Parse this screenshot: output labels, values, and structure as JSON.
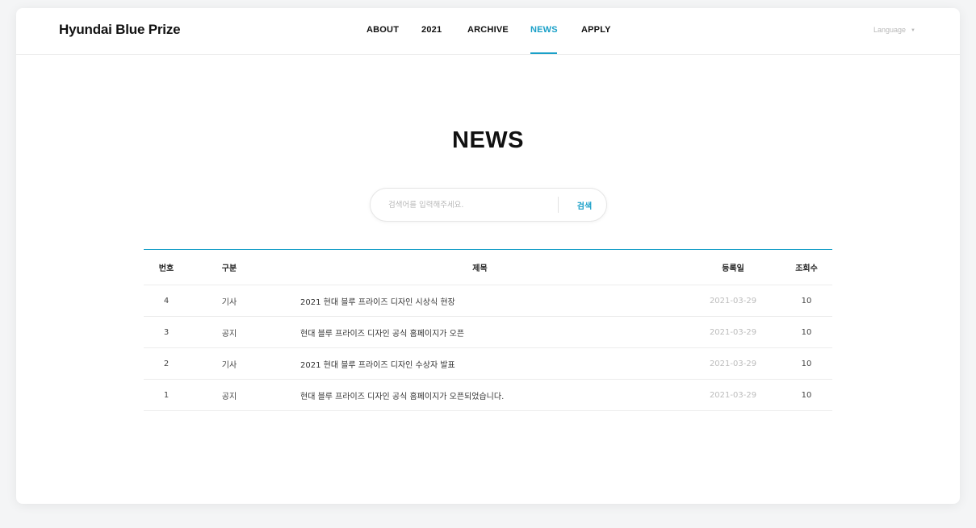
{
  "header": {
    "brand": "Hyundai Blue Prize",
    "nav": [
      {
        "label": "ABOUT"
      },
      {
        "label": "2021"
      },
      {
        "label": "ARCHIVE"
      },
      {
        "label": "NEWS"
      },
      {
        "label": "APPLY"
      }
    ],
    "active_nav": "NEWS",
    "language_label": "Language",
    "language_icon": "chevron-down-icon"
  },
  "page": {
    "title": "NEWS"
  },
  "search": {
    "placeholder": "검색어를 입력해주세요.",
    "value": "",
    "button_label": "검색"
  },
  "table": {
    "columns": [
      "번호",
      "구분",
      "제목",
      "등록일",
      "조회수"
    ],
    "rows": [
      {
        "no": "4",
        "category": "기사",
        "title": "2021 현대 블루 프라이즈 디자인 시상식 현장",
        "date": "2021-03-29",
        "views": "10"
      },
      {
        "no": "3",
        "category": "공지",
        "title": "현대 블루 프라이즈 디자인 공식 홈페이지가 오픈",
        "date": "2021-03-29",
        "views": "10"
      },
      {
        "no": "2",
        "category": "기사",
        "title": "2021 현대 블루 프라이즈 디자인 수상자 발표",
        "date": "2021-03-29",
        "views": "10"
      },
      {
        "no": "1",
        "category": "공지",
        "title": "현대 블루 프라이즈 디자인 공식 홈페이지가 오픈되었습니다.",
        "date": "2021-03-29",
        "views": "10"
      }
    ]
  },
  "colors": {
    "accent": "#1aa0c8",
    "text": "#111111",
    "muted": "#bcbcbc",
    "divider": "#ececec"
  }
}
